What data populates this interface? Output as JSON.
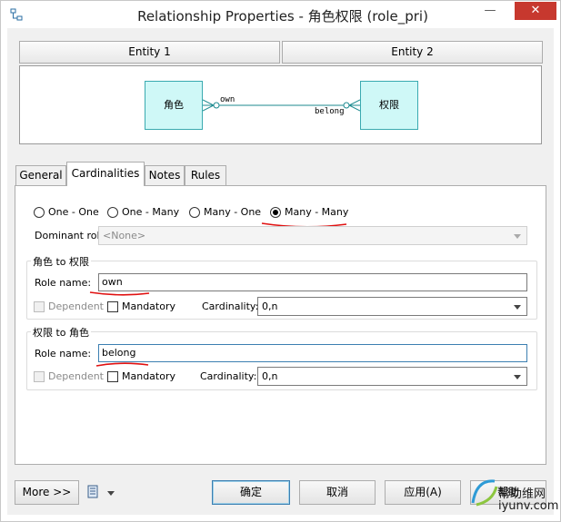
{
  "window": {
    "title": "Relationship Properties - 角色权限 (role_pri)",
    "close_icon": "close-icon"
  },
  "entities": {
    "entity1_label": "Entity 1",
    "entity2_label": "Entity 2"
  },
  "diagram": {
    "left_entity": "角色",
    "right_entity": "权限",
    "role1": "own",
    "role2": "belong"
  },
  "tabs": [
    {
      "label": "General"
    },
    {
      "label": "Cardinalities"
    },
    {
      "label": "Notes"
    },
    {
      "label": "Rules"
    }
  ],
  "cardinalities": {
    "options": [
      "One - One",
      "One - Many",
      "Many - One",
      "Many - Many"
    ],
    "selected": "Many - Many",
    "dominant_role_label": "Dominant role:",
    "dominant_role_value": "<None>"
  },
  "group1": {
    "title": "角色 to 权限",
    "role_name_label": "Role name:",
    "role_name_value": "own",
    "dependent_label": "Dependent",
    "mandatory_label": "Mandatory",
    "cardinality_label": "Cardinality:",
    "cardinality_value": "0,n"
  },
  "group2": {
    "title": "权限 to 角色",
    "role_name_label": "Role name:",
    "role_name_value": "belong",
    "dependent_label": "Dependent",
    "mandatory_label": "Mandatory",
    "cardinality_label": "Cardinality:",
    "cardinality_value": "0,n"
  },
  "footer": {
    "more_label": "More >>",
    "ok_label": "确定",
    "cancel_label": "取消",
    "apply_label": "应用(A)",
    "help_label": "帮助"
  },
  "watermark": {
    "line1": "帮助维网",
    "line2": "iyunv.com"
  },
  "colors": {
    "accent": "#3c7fb1",
    "entity_fill": "#cff8f7",
    "entity_border": "#3aaab0",
    "annotation_red": "#e01010",
    "close_red": "#c7382e"
  }
}
